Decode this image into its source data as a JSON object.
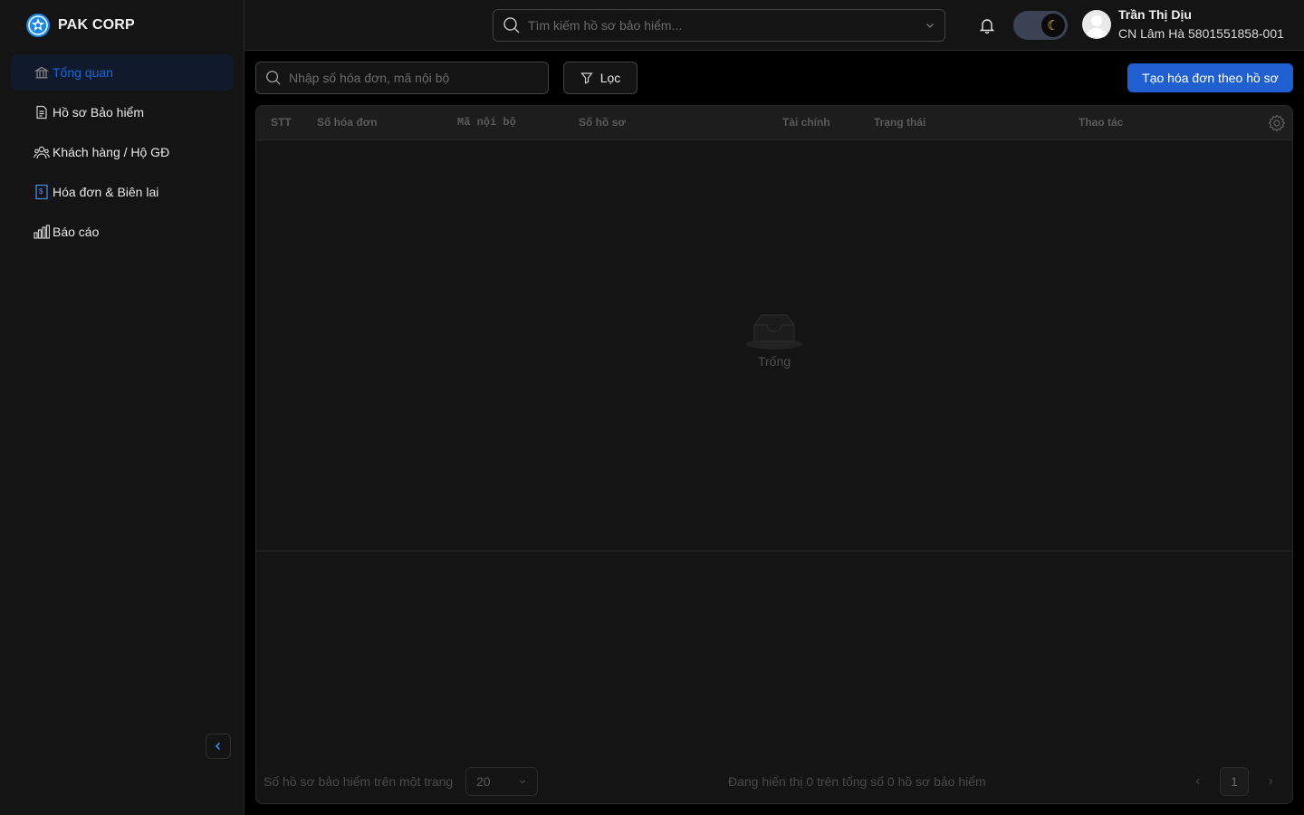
{
  "brand": {
    "name": "PAK CORP"
  },
  "sidebar": {
    "items": [
      {
        "label": "Tổng quan",
        "icon": "bank-icon",
        "active": true
      },
      {
        "label": "Hồ sơ Bảo hiểm",
        "icon": "document-icon"
      },
      {
        "label": "Khách hàng / Hộ GĐ",
        "icon": "users-icon"
      },
      {
        "label": "Hóa đơn & Biên lai",
        "icon": "receipt-icon"
      },
      {
        "label": "Báo cáo",
        "icon": "bar-chart-icon"
      }
    ],
    "collapse_icon": "chevron-left-icon"
  },
  "header": {
    "search_placeholder": "Tìm kiếm hồ sơ bảo hiểm...",
    "theme": "dark",
    "user": {
      "name": "Trần Thị Dịu",
      "org": "CN Lâm Hà 5801551858-001"
    }
  },
  "toolbar": {
    "search_placeholder": "Nhập số hóa đơn, mã nội bộ",
    "filter_label": "Lọc",
    "create_label": "Tạo hóa đơn theo hồ sơ"
  },
  "table": {
    "columns": [
      "STT",
      "Số hóa đơn",
      "Mã nội bộ",
      "Số hồ sơ",
      "Tài chính",
      "Trạng thái",
      "Thao tác"
    ],
    "rows": [],
    "empty_text": "Trống"
  },
  "pagination": {
    "page_size_label": "Số hồ sơ bảo hiểm trên một trang",
    "page_size": "20",
    "summary": "Đang hiển thị 0 trên tổng số 0 hồ sơ bảo hiểm",
    "current_page": "1"
  },
  "colors": {
    "accent": "#1f5fd0",
    "active_text": "#1668dc",
    "background": "#000000",
    "surface": "#141414"
  }
}
